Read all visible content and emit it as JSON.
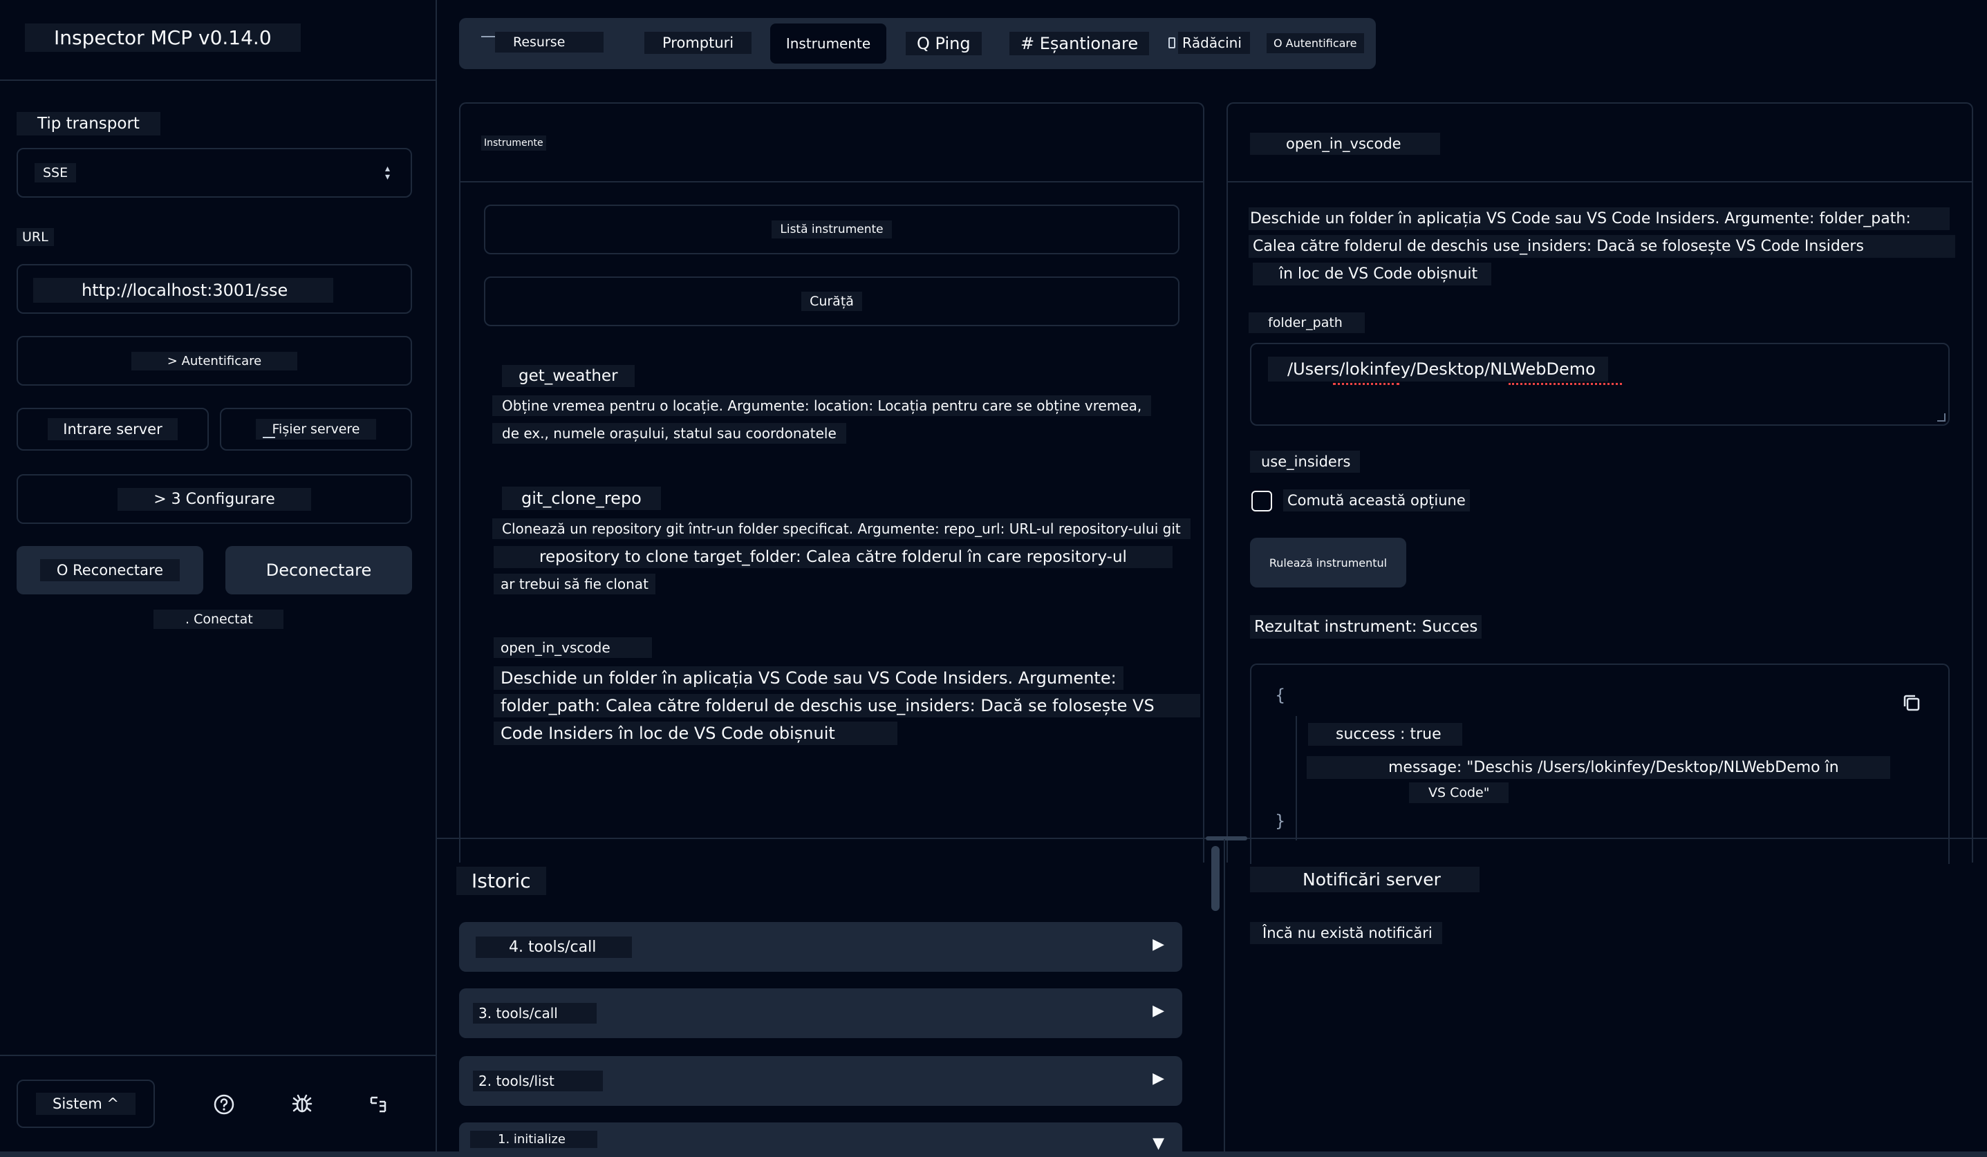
{
  "sidebar": {
    "title": "Inspector MCP v0.14.0",
    "transport_label": "Tip transport",
    "transport_value": "SSE",
    "url_label": "URL",
    "url_value": "http://localhost:3001/sse",
    "auth_button": "> Autentificare",
    "server_entry_button": "Intrare server",
    "servers_file_button": "Fișier servere",
    "config_button": "> 3 Configurare",
    "reconnect_button": "O Reconectare",
    "disconnect_button": "Deconectare",
    "status": ". Conectat",
    "theme_button": "Sistem ^"
  },
  "tabs": [
    {
      "label": "Resurse"
    },
    {
      "label": "Prompturi"
    },
    {
      "label": "Instrumente"
    },
    {
      "label": "Q Ping"
    },
    {
      "label": "# Eșantionare"
    },
    {
      "label": "Rădăcini"
    },
    {
      "label": "O Autentificare"
    }
  ],
  "tools_panel": {
    "title": "Instrumente",
    "list_button": "Listă instrumente",
    "clear_button": "Curăță",
    "tools": [
      {
        "name": "get_weather",
        "desc1": "Obține vremea pentru o locație. Argumente: location: Locația pentru care se obține vremea,",
        "desc2": "de ex., numele orașului, statul sau coordonatele",
        "desc3": ""
      },
      {
        "name": "git_clone_repo",
        "desc1": "Clonează un repository git într-un folder specificat. Argumente: repo_url: URL-ul repository-ului git",
        "desc2": "repository to clone target_folder: Calea către folderul în care repository-ul",
        "desc3": "ar trebui să fie clonat"
      },
      {
        "name": "open_in_vscode",
        "desc1": "Deschide un folder în aplicația VS Code sau VS Code Insiders. Argumente:",
        "desc2": "folder_path: Calea către folderul de deschis use_insiders: Dacă se folosește VS",
        "desc3": "Code Insiders în loc de VS Code obișnuit"
      }
    ]
  },
  "detail_panel": {
    "title": "open_in_vscode",
    "desc1": "Deschide un folder în aplicația VS Code sau VS Code Insiders. Argumente: folder_path:",
    "desc2": "Calea către folderul de deschis use_insiders: Dacă se folosește VS Code Insiders",
    "desc3": "în loc de VS Code obișnuit",
    "folder_path_label": "folder_path",
    "folder_path_value": "/Users/lokinfey/Desktop/NLWebDemo",
    "use_insiders_label": "use_insiders",
    "toggle_label": "Comută această opțiune",
    "run_button": "Rulează instrumentul",
    "result_label": "Rezultat instrument: Succes",
    "result_open": "{",
    "result_success": "success : true",
    "result_message1": "message: \"Deschis /Users/lokinfey/Desktop/NLWebDemo în",
    "result_message2": "VS Code\"",
    "result_close": "}"
  },
  "history": {
    "title": "Istoric",
    "items": [
      {
        "label": "4. tools/call"
      },
      {
        "label": "3. tools/call"
      },
      {
        "label": "2. tools/list"
      },
      {
        "label": "1. initialize"
      }
    ]
  },
  "notifications": {
    "title": "Notificări server",
    "empty": "Încă nu există notificări"
  },
  "colors": {
    "background": "#020817",
    "border": "#1e293b",
    "label_bg": "#0f1726",
    "spellcheck": "#ef4444"
  }
}
